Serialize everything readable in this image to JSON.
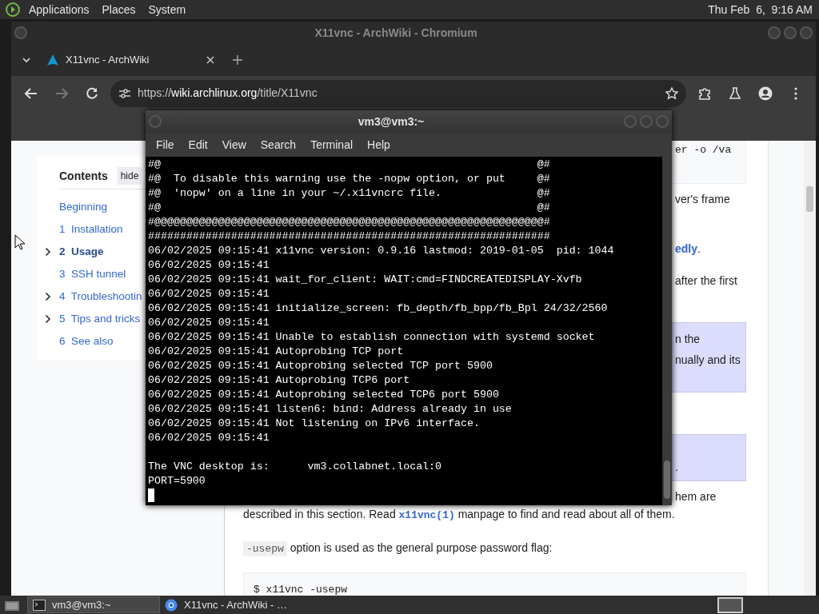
{
  "top_panel": {
    "menus": [
      "Applications",
      "Places",
      "System"
    ],
    "clock": "Thu Feb  6,  9:16 AM"
  },
  "browser": {
    "title": "X11vnc - ArchWiki - Chromium",
    "tabs": [
      {
        "label": "X11vnc - ArchWiki",
        "selected": true
      }
    ],
    "url": {
      "scheme": "https://",
      "host": "wiki.archlinux.org",
      "path": "/title/X11vnc"
    },
    "toc": {
      "title": "Contents",
      "hide_button": "hide",
      "items": [
        {
          "label": "Beginning",
          "expandable": false,
          "selected": false
        },
        {
          "number": "1",
          "label": "Installation",
          "expandable": false,
          "selected": false
        },
        {
          "number": "2",
          "label": "Usage",
          "expandable": true,
          "selected": true
        },
        {
          "number": "3",
          "label": "SSH tunnel",
          "expandable": false,
          "selected": false
        },
        {
          "number": "4",
          "label": "Troubleshootin",
          "expandable": true,
          "selected": false
        },
        {
          "number": "5",
          "label": "Tips and tricks",
          "expandable": true,
          "selected": false
        },
        {
          "number": "6",
          "label": "See also",
          "expandable": false,
          "selected": false
        }
      ]
    },
    "content": [
      {
        "kind": "code",
        "lines": [
          {
            "clipped": true,
            "segments": [
              {
                "kind": "plain",
                "text": "er -o /va"
              }
            ]
          }
        ]
      },
      {
        "kind": "para",
        "lines": [
          {
            "clipped": true,
            "segments": [
              {
                "kind": "plain",
                "text": "ver's frame"
              }
            ]
          }
        ]
      },
      {
        "kind": "para",
        "lines": [
          {
            "clipped": true,
            "segments": [
              {
                "kind": "link",
                "text": "edly"
              },
              {
                "kind": "plain",
                "text": "."
              }
            ]
          }
        ]
      },
      {
        "kind": "para",
        "lines": [
          {
            "clipped": true,
            "segments": [
              {
                "kind": "plain",
                "text": "after the first"
              }
            ]
          }
        ]
      },
      {
        "kind": "note",
        "lines": [
          {
            "clipped": true,
            "segments": [
              {
                "kind": "plain",
                "text": "n the"
              }
            ]
          },
          {
            "clipped": true,
            "segments": [
              {
                "kind": "plain",
                "text": "nually and its"
              }
            ]
          }
        ]
      },
      {
        "kind": "note",
        "lines": [
          {
            "clipped": true,
            "segments": [
              {
                "kind": "plain",
                "text": "."
              }
            ]
          }
        ]
      },
      {
        "kind": "para",
        "lines": [
          {
            "clipped": true,
            "segments": [
              {
                "kind": "plain",
                "text": "hem are"
              }
            ]
          },
          {
            "clipped": false,
            "segments": [
              {
                "kind": "plain",
                "text": "described in this section. Read "
              },
              {
                "kind": "manlink",
                "text": "x11vnc(1)"
              },
              {
                "kind": "plain",
                "text": " manpage to find and read about all of them."
              }
            ]
          }
        ]
      },
      {
        "kind": "para",
        "lines": [
          {
            "clipped": false,
            "segments": [
              {
                "kind": "code",
                "text": "-usepw"
              },
              {
                "kind": "plain",
                "text": " option is used as the general purpose password flag:"
              }
            ]
          }
        ]
      },
      {
        "kind": "code",
        "lines": [
          {
            "clipped": false,
            "segments": [
              {
                "kind": "plain",
                "text": "$ x11vnc -usepw"
              }
            ]
          }
        ]
      }
    ]
  },
  "terminal": {
    "title": "vm3@vm3:~",
    "menus": [
      "File",
      "Edit",
      "View",
      "Search",
      "Terminal",
      "Help"
    ],
    "lines": [
      "#@                                                           @#",
      "#@  To disable this warning use the -nopw option, or put     @#",
      "#@  'nopw' on a line in your ~/.x11vncrc file.               @#",
      "#@                                                           @#",
      "#@@@@@@@@@@@@@@@@@@@@@@@@@@@@@@@@@@@@@@@@@@@@@@@@@@@@@@@@@@@@@#",
      "###############################################################",
      "06/02/2025 09:15:41 x11vnc version: 0.9.16 lastmod: 2019-01-05  pid: 1044",
      "06/02/2025 09:15:41",
      "06/02/2025 09:15:41 wait_for_client: WAIT:cmd=FINDCREATEDISPLAY-Xvfb",
      "06/02/2025 09:15:41",
      "06/02/2025 09:15:41 initialize_screen: fb_depth/fb_bpp/fb_Bpl 24/32/2560",
      "06/02/2025 09:15:41",
      "06/02/2025 09:15:41 Unable to establish connection with systemd socket",
      "06/02/2025 09:15:41 Autoprobing TCP port",
      "06/02/2025 09:15:41 Autoprobing selected TCP port 5900",
      "06/02/2025 09:15:41 Autoprobing TCP6 port",
      "06/02/2025 09:15:41 Autoprobing selected TCP6 port 5900",
      "06/02/2025 09:15:41 listen6: bind: Address already in use",
      "06/02/2025 09:15:41 Not listening on IPv6 interface.",
      "06/02/2025 09:15:41"
    ],
    "footer_lines": [
      "The VNC desktop is:      vm3.collabnet.local:0",
      "PORT=5900"
    ]
  },
  "taskbar": {
    "items": [
      {
        "kind": "terminal",
        "label": "vm3@vm3:~",
        "selected": true
      },
      {
        "kind": "browser",
        "label": "X11vnc - ArchWiki - …",
        "selected": false
      }
    ]
  }
}
